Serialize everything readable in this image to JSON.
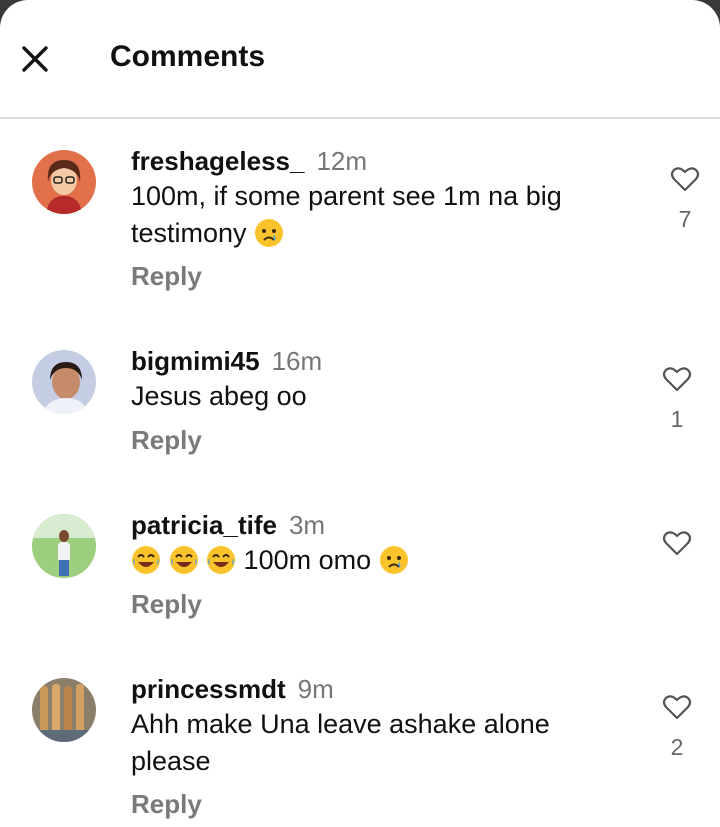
{
  "header": {
    "title": "Comments",
    "close_icon": "close-icon"
  },
  "comments": [
    {
      "username": "freshageless_",
      "time": "12m",
      "text": "100m, if some parent see 1m na big testimony",
      "text_emojis": [
        "crying-face"
      ],
      "reply": "Reply",
      "likes": "7",
      "avatar_color": "#e2704a"
    },
    {
      "username": "bigmimi45",
      "time": "16m",
      "text": "Jesus abeg oo",
      "text_emojis": [],
      "reply": "Reply",
      "likes": "1",
      "avatar_color": "#c5cde4"
    },
    {
      "username": "patricia_tife",
      "time": "3m",
      "text_prefix_emojis": [
        "tears-of-joy",
        "tears-of-joy",
        "tears-of-joy"
      ],
      "text": "100m omo",
      "text_emojis": [
        "crying-face"
      ],
      "reply": "Reply",
      "likes": "",
      "avatar_color": "#6fae5a"
    },
    {
      "username": "princessmdt",
      "time": "9m",
      "text": "Ahh make Una leave ashake alone please",
      "text_emojis": [],
      "reply": "Reply",
      "likes": "2",
      "avatar_color": "#9a8a6e"
    }
  ],
  "icons": {
    "like": "heart-outline-icon"
  }
}
